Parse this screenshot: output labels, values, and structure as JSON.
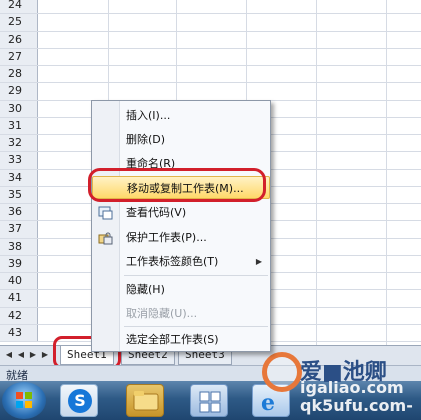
{
  "grid": {
    "row_numbers": [
      "24",
      "25",
      "26",
      "27",
      "28",
      "29",
      "30",
      "31",
      "32",
      "33",
      "34",
      "35",
      "36",
      "37",
      "38",
      "39",
      "40",
      "41",
      "42",
      "43"
    ]
  },
  "sheet_tabs": {
    "nav_first": "◀",
    "nav_prev": "◀",
    "nav_next": "▶",
    "nav_last": "▶",
    "tabs": [
      "Sheet1",
      "Sheet2",
      "Sheet3"
    ],
    "active_tab": "Sheet1"
  },
  "status": {
    "text": "就绪"
  },
  "context_menu": {
    "items": [
      {
        "label": "插入(I)...",
        "enabled": true
      },
      {
        "label": "删除(D)",
        "enabled": true
      },
      {
        "label": "重命名(R)",
        "enabled": true
      },
      {
        "label": "移动或复制工作表(M)...",
        "enabled": true,
        "highlighted": true
      },
      {
        "label": "查看代码(V)",
        "enabled": true,
        "icon": "view-code-icon"
      },
      {
        "label": "保护工作表(P)...",
        "enabled": true,
        "icon": "protect-sheet-icon"
      },
      {
        "label": "工作表标签颜色(T)",
        "enabled": true,
        "submenu": true
      },
      {
        "label": "隐藏(H)",
        "enabled": true
      },
      {
        "label": "取消隐藏(U)...",
        "enabled": false
      },
      {
        "label": "选定全部工作表(S)",
        "enabled": true
      }
    ]
  },
  "watermark": {
    "logo_text": "爱■池卿",
    "site_line1": "igaliao.com",
    "site_line2": "qk5ufu.com-"
  },
  "colors": {
    "highlight_ring": "#d21f2b",
    "menu_highlight": "#ffd96a",
    "taskbar": "#2e5a86"
  }
}
